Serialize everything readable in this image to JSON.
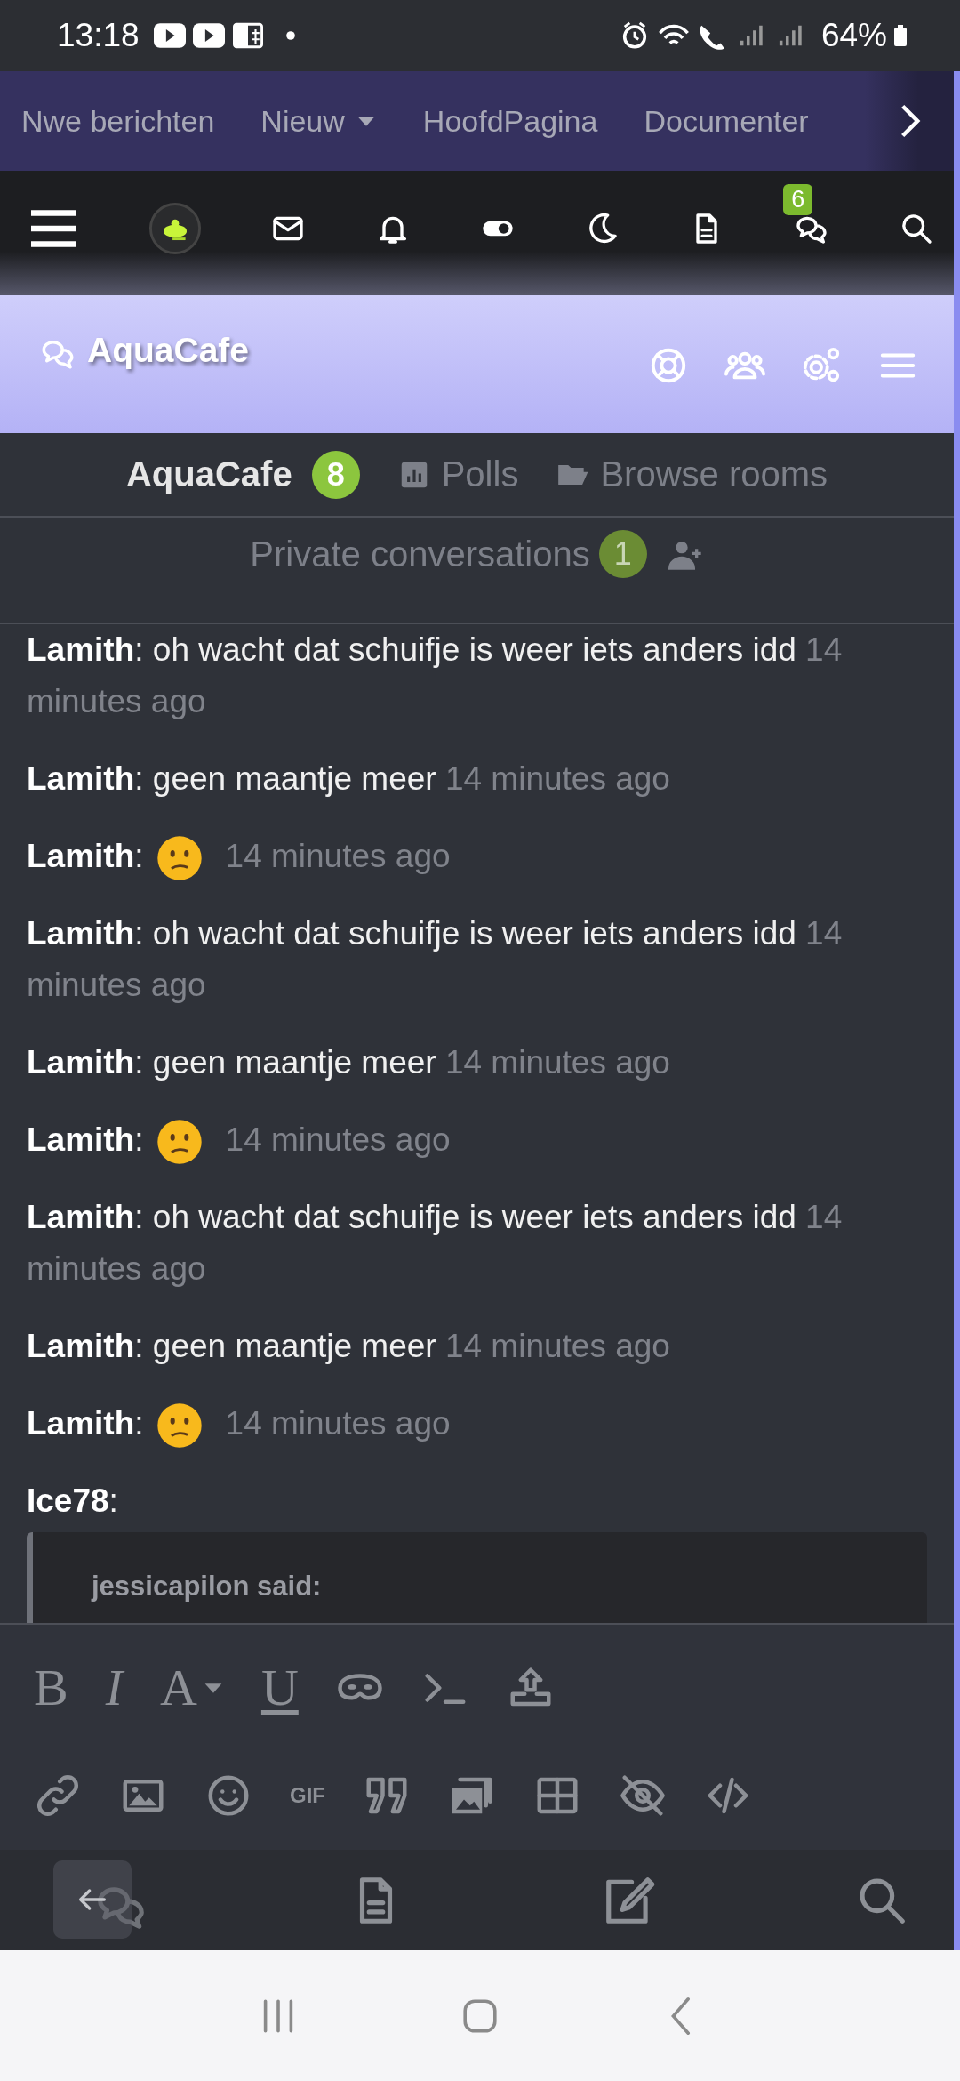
{
  "status_bar": {
    "time": "13:18",
    "battery": "64%"
  },
  "nav": {
    "items": [
      {
        "label": "Nwe berichten",
        "dropdown": false
      },
      {
        "label": "Nieuw",
        "dropdown": true
      },
      {
        "label": "HoofdPagina",
        "dropdown": false
      },
      {
        "label": "Documenter",
        "dropdown": false
      }
    ]
  },
  "top_bar": {
    "chat_badge": "6"
  },
  "header": {
    "title": "AquaCafe"
  },
  "tabs": [
    {
      "label": "AquaCafe",
      "badge": "8",
      "selected": true,
      "kind": "room"
    },
    {
      "label": "Polls",
      "selected": false,
      "kind": "polls"
    },
    {
      "label": "Browse rooms",
      "selected": false,
      "kind": "browse"
    }
  ],
  "private": {
    "label": "Private conversations",
    "badge": "1"
  },
  "messages": [
    {
      "kind": "text",
      "sender": "**Lamith**:",
      "text": "oh wacht dat schuifje is weer iets anders idd",
      "time": "14 minutes ago"
    },
    {
      "kind": "text",
      "sender": "**Lamith**:",
      "text": "geen maantje meer",
      "time": "14 minutes ago"
    },
    {
      "kind": "emoji",
      "sender": "**Lamith**:",
      "time": "14 minutes ago"
    },
    {
      "kind": "text",
      "sender": "**Lamith**:",
      "text": "oh wacht dat schuifje is weer iets anders idd",
      "time": "14 minutes ago"
    },
    {
      "kind": "text",
      "sender": "**Lamith**:",
      "text": "geen maantje meer",
      "time": "14 minutes ago"
    },
    {
      "kind": "emoji",
      "sender": "**Lamith**:",
      "time": "14 minutes ago"
    },
    {
      "kind": "text",
      "sender": "**Lamith**:",
      "text": "oh wacht dat schuifje is weer iets anders idd",
      "time": "14 minutes ago"
    },
    {
      "kind": "text",
      "sender": "**Lamith**:",
      "text": "geen maantje meer",
      "time": "14 minutes ago"
    },
    {
      "kind": "emoji",
      "sender": "**Lamith**:",
      "time": "14 minutes ago"
    },
    {
      "kind": "quote",
      "sender": "**Ice78**:",
      "quote_author": "jessicapilon said:"
    }
  ],
  "toolbar": {
    "rows": [
      [
        {
          "kind": "bold",
          "glyph": "B"
        },
        {
          "kind": "italic",
          "glyph": "I"
        },
        {
          "kind": "color",
          "glyph": "A"
        },
        {
          "kind": "underline",
          "glyph": "U"
        },
        {
          "kind": "spoiler"
        },
        {
          "kind": "code"
        },
        {
          "kind": "upload"
        }
      ],
      [
        {
          "kind": "link"
        },
        {
          "kind": "image"
        },
        {
          "kind": "smilie"
        },
        {
          "kind": "gif",
          "glyph": "GIF"
        },
        {
          "kind": "quote"
        },
        {
          "kind": "gallery"
        },
        {
          "kind": "table"
        },
        {
          "kind": "hide"
        },
        {
          "kind": "html"
        }
      ]
    ]
  }
}
